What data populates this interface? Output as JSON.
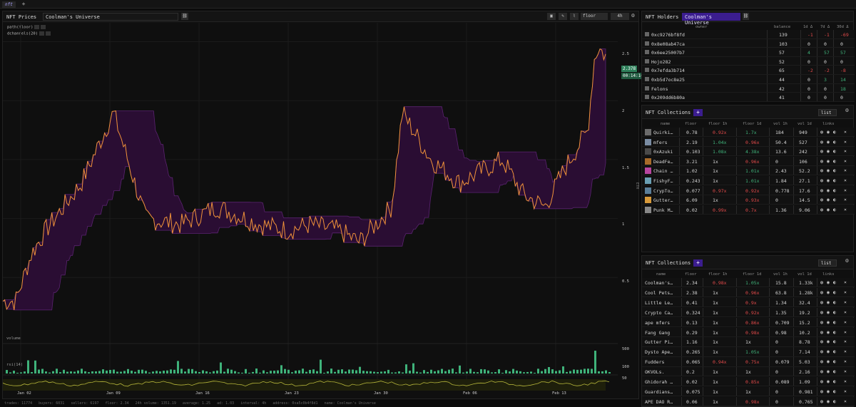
{
  "tabs": [
    {
      "label": "nft"
    }
  ],
  "prices_panel": {
    "title": "NFT Prices",
    "collection": "Coolman's Universe",
    "metric": "floor",
    "interval": "4h",
    "legend": [
      "path(floor)",
      "dchannels(20)"
    ],
    "y_ticks": [
      "2.5",
      "2",
      "1.5",
      "1",
      "0.5"
    ],
    "y_unit": "ETH",
    "last_price": "2.378",
    "countdown": "00:14:10",
    "x_ticks": [
      "Jan 02",
      "Jan 09",
      "Jan 16",
      "Jan 23",
      "Jan 30",
      "Feb 06",
      "Feb 13"
    ],
    "volume_label": "volume",
    "volume_tick": "500",
    "rsi_label": "rsi(14)",
    "rsi_ticks": [
      "100",
      "50"
    ],
    "status": [
      "trades: 11774",
      "buyers: 6031",
      "sellers: 6197",
      "floor: 2.34",
      "24h volume: 1351.19",
      "average: 1.25",
      "ad: 1.03",
      "interval: 4h",
      "address: 0xa5c0b4f8d1",
      "name: Coolman's Universe"
    ]
  },
  "chart_data": {
    "type": "line",
    "x": [
      "Jan 02",
      "Jan 09",
      "Jan 16",
      "Jan 23",
      "Jan 30",
      "Feb 06",
      "Feb 13"
    ],
    "series": [
      {
        "name": "path(floor)",
        "values": [
          0.2,
          1.6,
          0.95,
          0.95,
          0.9,
          1.7,
          1.05,
          1.5,
          1.1,
          1.6,
          2.45,
          2.38
        ]
      },
      {
        "name": "dchannels(20)",
        "values": []
      }
    ],
    "ylim": [
      0,
      2.6
    ]
  },
  "holders": {
    "title": "NFT Holders",
    "collection": "Coolman's Universe",
    "columns": [
      "owner",
      "balance",
      "1d Δ",
      "7d Δ",
      "30d Δ"
    ],
    "rows": [
      {
        "owner": "0xc9276bf8fd",
        "balance": "139",
        "d1": "-1",
        "d7": "-1",
        "d30": "-69"
      },
      {
        "owner": "0x8e08ab47ca",
        "balance": "103",
        "d1": "0",
        "d7": "0",
        "d30": "0"
      },
      {
        "owner": "0x6ee25007b7",
        "balance": "57",
        "d1": "4",
        "d7": "57",
        "d30": "57"
      },
      {
        "owner": "Hojo282",
        "balance": "52",
        "d1": "0",
        "d7": "0",
        "d30": "0"
      },
      {
        "owner": "0x7efda3b714",
        "balance": "65",
        "d1": "-2",
        "d7": "-2",
        "d30": "-8"
      },
      {
        "owner": "0xb5d7oc8e25",
        "balance": "44",
        "d1": "0",
        "d7": "3",
        "d30": "14"
      },
      {
        "owner": "Felons",
        "balance": "42",
        "d1": "0",
        "d7": "0",
        "d30": "18"
      },
      {
        "owner": "0x209dd6b80a",
        "balance": "41",
        "d1": "0",
        "d7": "0",
        "d30": "0"
      }
    ]
  },
  "collections1": {
    "title": "NFT Collections",
    "view": "list",
    "columns": [
      "name",
      "floor",
      "floor 1h",
      "floor 1d",
      "vol 1h",
      "vol 1d",
      "links"
    ],
    "rows": [
      {
        "name": "Quirki…",
        "floor": "0.78",
        "f1h": "0.92x",
        "f1d": "1.7x",
        "v1h": "184",
        "v1d": "949"
      },
      {
        "name": "mfers",
        "floor": "2.19",
        "f1h": "1.04x",
        "f1d": "0.96x",
        "v1h": "50.4",
        "v1d": "527"
      },
      {
        "name": "0xAzuki",
        "floor": "0.103",
        "f1h": "1.08x",
        "f1d": "4.38x",
        "v1h": "13.6",
        "v1d": "242"
      },
      {
        "name": "DeadFe…",
        "floor": "3.21",
        "f1h": "1x",
        "f1d": "0.96x",
        "v1h": "0",
        "v1d": "106"
      },
      {
        "name": "Chain …",
        "floor": "1.02",
        "f1h": "1x",
        "f1d": "1.01x",
        "v1h": "2.43",
        "v1d": "52.2"
      },
      {
        "name": "FishyF…",
        "floor": "0.243",
        "f1h": "1x",
        "f1d": "1.01x",
        "v1h": "1.84",
        "v1d": "27.1"
      },
      {
        "name": "CrypTo…",
        "floor": "0.077",
        "f1h": "0.97x",
        "f1d": "0.92x",
        "v1h": "0.778",
        "v1d": "17.6"
      },
      {
        "name": "Gutter…",
        "floor": "6.09",
        "f1h": "1x",
        "f1d": "0.93x",
        "v1h": "0",
        "v1d": "14.5"
      },
      {
        "name": "Punk M…",
        "floor": "0.02",
        "f1h": "0.99x",
        "f1d": "0.7x",
        "v1h": "1.36",
        "v1d": "9.06"
      }
    ]
  },
  "collections2": {
    "title": "NFT Collections",
    "view": "list",
    "columns": [
      "name",
      "floor",
      "floor 1h",
      "floor 1d",
      "vol 1h",
      "vol 1d",
      "links"
    ],
    "rows": [
      {
        "name": "Coolman's…",
        "floor": "2.34",
        "f1h": "0.98x",
        "f1d": "1.05x",
        "v1h": "15.8",
        "v1d": "1.33k"
      },
      {
        "name": "Cool Pets…",
        "floor": "2.38",
        "f1h": "1x",
        "f1d": "0.96x",
        "v1h": "63.8",
        "v1d": "1.28k"
      },
      {
        "name": "Little Le…",
        "floor": "0.41",
        "f1h": "1x",
        "f1d": "0.9x",
        "v1h": "1.34",
        "v1d": "32.4"
      },
      {
        "name": "Crypto Ca…",
        "floor": "0.324",
        "f1h": "1x",
        "f1d": "0.92x",
        "v1h": "1.35",
        "v1d": "19.2"
      },
      {
        "name": "ape mfers",
        "floor": "0.13",
        "f1h": "1x",
        "f1d": "0.86x",
        "v1h": "0.709",
        "v1d": "15.2"
      },
      {
        "name": "Fang Gang",
        "floor": "0.29",
        "f1h": "1x",
        "f1d": "0.98x",
        "v1h": "0.98",
        "v1d": "10.2"
      },
      {
        "name": "Gutter Pi…",
        "floor": "1.16",
        "f1h": "1x",
        "f1d": "1x",
        "v1h": "0",
        "v1d": "8.78"
      },
      {
        "name": "Dysto Ape…",
        "floor": "0.265",
        "f1h": "1x",
        "f1d": "1.05x",
        "v1h": "0",
        "v1d": "7.14"
      },
      {
        "name": "Fudders",
        "floor": "0.065",
        "f1h": "0.94x",
        "f1d": "0.75x",
        "v1h": "0.079",
        "v1d": "5.03"
      },
      {
        "name": "OKVOLs.",
        "floor": "0.2",
        "f1h": "1x",
        "f1d": "1x",
        "v1h": "0",
        "v1d": "2.16"
      },
      {
        "name": "Ghidorah …",
        "floor": "0.02",
        "f1h": "1x",
        "f1d": "0.85x",
        "v1h": "0.089",
        "v1d": "1.09"
      },
      {
        "name": "Guardians…",
        "floor": "0.075",
        "f1h": "1x",
        "f1d": "1x",
        "v1h": "0",
        "v1d": "0.981"
      },
      {
        "name": "APE DAO R…",
        "floor": "0.06",
        "f1h": "1x",
        "f1d": "0.98x",
        "v1h": "0",
        "v1d": "0.765"
      }
    ]
  },
  "colors": {
    "accent": "#3b1d8f",
    "line": "#f0923a",
    "channel": "#2a0d33",
    "volume": "#3fb27a",
    "rsi": "#b5b53a",
    "neg": "#e24a4a",
    "pos": "#3fb27a"
  }
}
